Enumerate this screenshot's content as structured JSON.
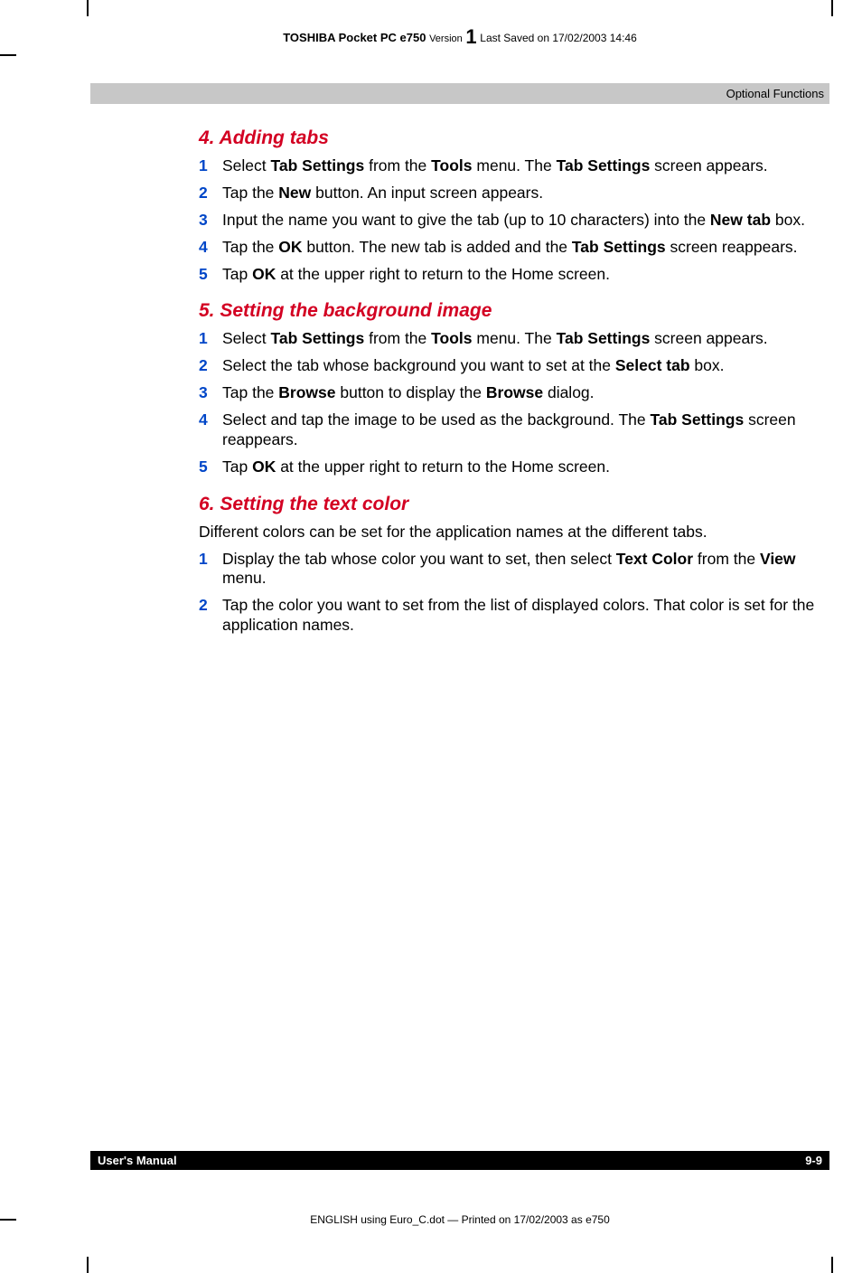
{
  "header": {
    "product": "TOSHIBA Pocket PC e750",
    "version_label": "Version",
    "version_num": "1",
    "saved": "Last Saved on 17/02/2003 14:46"
  },
  "gray_bar": "Optional Functions",
  "sections": [
    {
      "title": "4. Adding tabs",
      "intro": "",
      "steps": [
        [
          [
            "Select "
          ],
          [
            "b",
            "Tab Settings"
          ],
          [
            " from the "
          ],
          [
            "b",
            "Tools"
          ],
          [
            " menu. The "
          ],
          [
            "b",
            "Tab Settings"
          ],
          [
            " screen appears."
          ]
        ],
        [
          [
            "Tap the "
          ],
          [
            "b",
            "New"
          ],
          [
            " button. An input screen appears."
          ]
        ],
        [
          [
            "Input the name you want to give the tab (up to 10 characters) into the "
          ],
          [
            "b",
            "New tab"
          ],
          [
            " box."
          ]
        ],
        [
          [
            "Tap the "
          ],
          [
            "b",
            "OK"
          ],
          [
            " button. The new tab is added and the "
          ],
          [
            "b",
            "Tab Settings"
          ],
          [
            " screen reappears."
          ]
        ],
        [
          [
            "Tap "
          ],
          [
            "b",
            "OK"
          ],
          [
            " at the upper right to return to the Home screen."
          ]
        ]
      ]
    },
    {
      "title": "5. Setting the background image",
      "intro": "",
      "steps": [
        [
          [
            "Select "
          ],
          [
            "b",
            "Tab Settings"
          ],
          [
            " from the "
          ],
          [
            "b",
            "Tools"
          ],
          [
            " menu. The "
          ],
          [
            "b",
            "Tab Settings"
          ],
          [
            " screen appears."
          ]
        ],
        [
          [
            "Select the tab whose background you want to set at the "
          ],
          [
            "b",
            "Select tab"
          ],
          [
            " box."
          ]
        ],
        [
          [
            "Tap the "
          ],
          [
            "b",
            "Browse"
          ],
          [
            " button to display the "
          ],
          [
            "b",
            "Browse"
          ],
          [
            " dialog."
          ]
        ],
        [
          [
            "Select and tap the image to be used as the background. The "
          ],
          [
            "b",
            "Tab Settings"
          ],
          [
            " screen reappears."
          ]
        ],
        [
          [
            "Tap "
          ],
          [
            "b",
            "OK"
          ],
          [
            " at the upper right to return to the Home screen."
          ]
        ]
      ]
    },
    {
      "title": "6. Setting the text color",
      "intro": "Different colors can be set for the application names at the different tabs.",
      "steps": [
        [
          [
            "Display the tab whose color you want to set, then select "
          ],
          [
            "b",
            "Text Color"
          ],
          [
            " from the "
          ],
          [
            "b",
            "View"
          ],
          [
            " menu."
          ]
        ],
        [
          [
            "Tap the color you want to set from the list of displayed colors. That color is set for the application names."
          ]
        ]
      ]
    }
  ],
  "footer": {
    "left": "User's Manual",
    "right": "9-9"
  },
  "print_line": "ENGLISH using Euro_C.dot — Printed on 17/02/2003 as e750"
}
